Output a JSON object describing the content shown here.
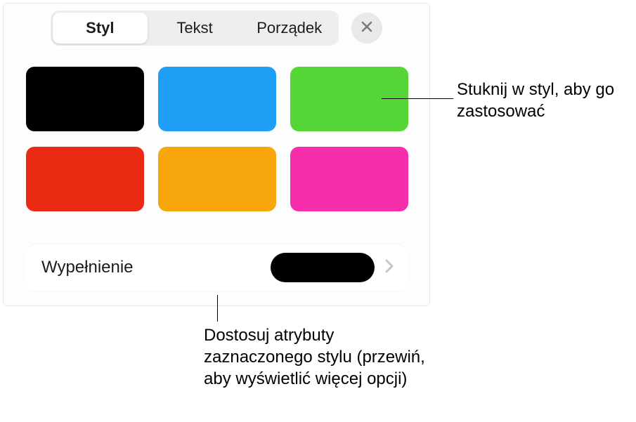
{
  "tabs": {
    "style": "Styl",
    "text": "Tekst",
    "arrange": "Porządek",
    "selected": "style"
  },
  "close_icon": "close-icon",
  "swatches": [
    {
      "name": "style-swatch-black",
      "color": "#000000"
    },
    {
      "name": "style-swatch-blue",
      "color": "#1e9ef4"
    },
    {
      "name": "style-swatch-green",
      "color": "#56d636"
    },
    {
      "name": "style-swatch-red",
      "color": "#ea2a12"
    },
    {
      "name": "style-swatch-orange",
      "color": "#f7a60b"
    },
    {
      "name": "style-swatch-pink",
      "color": "#f62eab"
    }
  ],
  "fill": {
    "label": "Wypełnienie",
    "color": "#000000"
  },
  "callouts": {
    "tap_style": "Stuknij w styl, aby go zastosować",
    "customize": "Dostosuj atrybuty zaznaczonego stylu (przewiń, aby wyświetlić więcej opcji)"
  }
}
